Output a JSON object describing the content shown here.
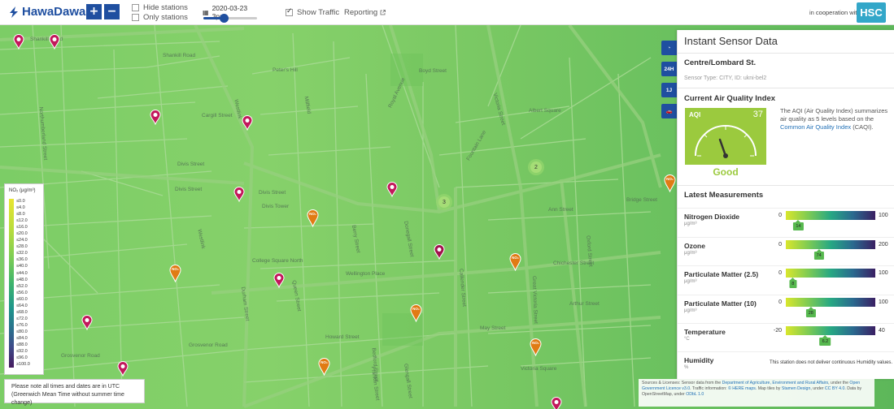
{
  "app": {
    "name": "HawaDawa"
  },
  "toolbar": {
    "zoom_in": "+",
    "zoom_out": "−",
    "hide_stations": "Hide stations",
    "only_stations": "Only stations",
    "date": "2020-03-23 3pm",
    "time_slider_fraction": 0.38,
    "show_traffic": "Show Traffic",
    "reporting": "Reporting",
    "cooperation": "in cooperation with",
    "partner_logo": "HSC"
  },
  "map": {
    "streets": [
      "Shankill Road",
      "Shankill Road",
      "Peter's Hill",
      "Millfield",
      "Westlink",
      "Northumberland Street",
      "Cargill Street",
      "Divis Street",
      "Divis Street",
      "Divis Street",
      "Divis Tower",
      "Westlink",
      "College Square North",
      "Wellington Place",
      "Durham Street",
      "Grosvenor Road",
      "Grosvenor Road",
      "Howard Street",
      "Bedford Street",
      "Great Victoria Street",
      "Victoria Street",
      "Royal Avenue",
      "Boyd Street",
      "Queen Street",
      "Callender Street",
      "May Street",
      "Ann Street",
      "Oxford Street",
      "Bridge Street",
      "Albert Square",
      "Victoria Square",
      "Donegall Street",
      "Berry Street",
      "Chichester Street",
      "Fountain Lane",
      "Arthur Street",
      "Franklin Street",
      "Glengall Street"
    ],
    "clusters": [
      "2",
      "3"
    ],
    "no2_badge": "NO₂"
  },
  "legend": {
    "title": "NO₂ (μg/m³)",
    "items": [
      "≤0.0",
      "≤4.0",
      "≤8.0",
      "≤12.0",
      "≤16.0",
      "≤20.0",
      "≤24.0",
      "≤28.0",
      "≤32.0",
      "≤36.0",
      "≤40.0",
      "≤44.0",
      "≤48.0",
      "≤52.0",
      "≤56.0",
      "≤60.0",
      "≤64.0",
      "≤68.0",
      "≤72.0",
      "≤76.0",
      "≤80.0",
      "≤84.0",
      "≤88.0",
      "≤92.0",
      "≤96.0",
      "≥100.0"
    ]
  },
  "note": "Please note all times and dates are in UTC (Greenwich Mean Time without summer time change)",
  "side_tabs": [
    "◔",
    "24H",
    "1J",
    "🚗"
  ],
  "panel": {
    "title": "Instant Sensor Data",
    "station": "Centre/Lombard St.",
    "sensor_type": "Sensor Type: CITY, ID: ukni-bel2",
    "aqi_heading": "Current Air Quality Index",
    "aqi_label": "AQI",
    "aqi_value": "37",
    "aqi_status": "Good",
    "aqi_desc_1": "The AQI (Air Quality Index) summarizes air quality as 5 levels based on the ",
    "aqi_desc_link": "Common Air Quality Index",
    "aqi_desc_2": " (CAQI).",
    "measurements_heading": "Latest Measurements",
    "measurements": [
      {
        "name": "Nitrogen Dioxide",
        "unit": "μg/m³",
        "min": "0",
        "max": "100",
        "value": "14",
        "fraction": 0.14
      },
      {
        "name": "Ozone",
        "unit": "μg/m³",
        "min": "0",
        "max": "200",
        "value": "74",
        "fraction": 0.37
      },
      {
        "name": "Particulate Matter (2.5)",
        "unit": "μg/m³",
        "min": "0",
        "max": "100",
        "value": "8",
        "fraction": 0.08
      },
      {
        "name": "Particulate Matter (10)",
        "unit": "μg/m³",
        "min": "0",
        "max": "100",
        "value": "28",
        "fraction": 0.28
      },
      {
        "name": "Temperature",
        "unit": "°C",
        "min": "-20",
        "max": "40",
        "value": "6.2",
        "fraction": 0.44
      },
      {
        "name": "Humidity",
        "unit": "%",
        "message": "This station does not deliver continuous Humidity values."
      }
    ]
  },
  "sources": {
    "t1": "Sources & Licenses: Sensor data from the ",
    "l1": "Department of Agriculture, Environment and Rural Affairs",
    "t2": ", under the ",
    "l2": "Open Government Licence v3.0",
    "t3": ". Traffic information: ",
    "l3": "© HERE maps",
    "t4": ". Map tiles by ",
    "l4": "Stamen Design",
    "t5": ", under ",
    "l5": "CC BY 4.0",
    "t6": ". Data by OpenStreetMap, under ",
    "l6": "ODbL 1.0"
  },
  "colors": {
    "brand": "#1f4fa0",
    "aqi_good": "#9bca3e",
    "pin_magenta": "#c2185b",
    "pin_orange": "#e07b14",
    "partner": "#33a7c9"
  }
}
